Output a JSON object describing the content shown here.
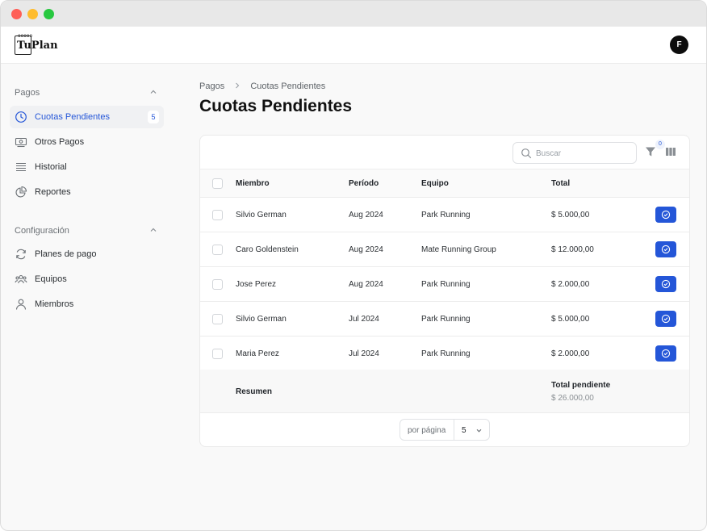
{
  "app": {
    "logo_text": "TuPlan",
    "avatar_initial": "F"
  },
  "colors": {
    "accent": "#2456d8",
    "window_close": "#fe5f57",
    "window_minimize": "#febc2e",
    "window_zoom": "#28c840"
  },
  "sidebar": {
    "sections": [
      {
        "title": "Pagos",
        "items": [
          {
            "label": "Cuotas Pendientes",
            "icon": "clock-icon",
            "badge": "5",
            "active": true
          },
          {
            "label": "Otros Pagos",
            "icon": "banknote-icon"
          },
          {
            "label": "Historial",
            "icon": "list-icon"
          },
          {
            "label": "Reportes",
            "icon": "pie-chart-icon"
          }
        ]
      },
      {
        "title": "Configuración",
        "items": [
          {
            "label": "Planes de pago",
            "icon": "refresh-icon"
          },
          {
            "label": "Equipos",
            "icon": "users-group-icon"
          },
          {
            "label": "Miembros",
            "icon": "user-icon"
          }
        ]
      }
    ]
  },
  "breadcrumb": {
    "parent": "Pagos",
    "current": "Cuotas Pendientes"
  },
  "page": {
    "title": "Cuotas Pendientes"
  },
  "toolbar": {
    "search_placeholder": "Buscar",
    "filter_count": "0"
  },
  "table": {
    "headers": [
      "Miembro",
      "Período",
      "Equipo",
      "Total"
    ],
    "rows": [
      [
        "Silvio German",
        "Aug 2024",
        "Park Running",
        "$ 5.000,00"
      ],
      [
        "Caro Goldenstein",
        "Aug 2024",
        "Mate Running Group",
        "$ 12.000,00"
      ],
      [
        "Jose Perez",
        "Aug 2024",
        "Park Running",
        "$ 2.000,00"
      ],
      [
        "Silvio German",
        "Jul 2024",
        "Park Running",
        "$ 5.000,00"
      ],
      [
        "Maria Perez",
        "Jul 2024",
        "Park Running",
        "$ 2.000,00"
      ]
    ]
  },
  "summary": {
    "label": "Resumen",
    "total_title": "Total pendiente",
    "total_value": "$ 26.000,00"
  },
  "pagination": {
    "per_page_label": "por página",
    "per_page_value": "5"
  }
}
